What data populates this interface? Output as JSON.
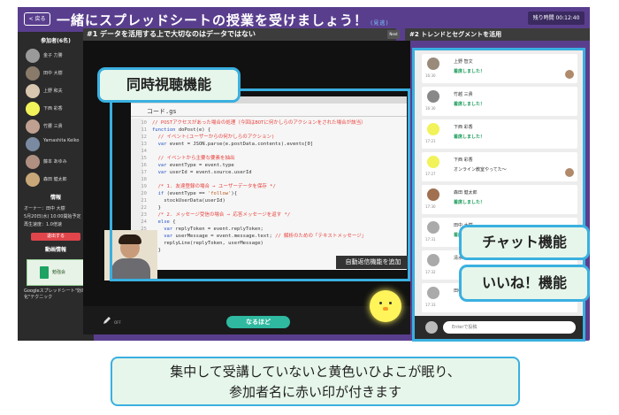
{
  "titlebar": {
    "back_label": "< 戻る",
    "title": "一緒にスプレッドシートの授業を受けましょう！",
    "title_tag": "(見逃)",
    "remaining_time": "残り時間 00:12:40"
  },
  "sidebar": {
    "participants_heading": "参加者(6名)",
    "members": [
      {
        "name": "金子 力勝"
      },
      {
        "name": "田中 大樹"
      },
      {
        "name": "上野 和夫"
      },
      {
        "name": "下西 彩香"
      },
      {
        "name": "竹腰 三貴"
      },
      {
        "name": "Yamashita Keiko"
      },
      {
        "name": "藤本 あゆみ"
      },
      {
        "name": "森田 健太郎"
      }
    ],
    "info_heading": "情報",
    "info_lines": [
      "オーナー：田中 大樹",
      "5月20日(水) 10:00開始予定",
      "再生速度：1.0倍速"
    ],
    "exit_label": "退出する",
    "video_heading": "動画情報",
    "video_thumb_text": "勉強会",
    "video_caption": "Googleスプレッドシート\"効率化\"テクニック"
  },
  "main": {
    "tab_label": "#1 データを活用する上で大切なのはデータではない",
    "next_label": "Next",
    "file_tab": "コード.gs",
    "code_lines": [
      {
        "ln": "10",
        "segs": [
          {
            "t": "// POSTアクセスがあった場合の処理（今回はBOTに何かしらのアクションをされた場合が該当）",
            "c": "c-cm"
          }
        ]
      },
      {
        "ln": "11",
        "segs": [
          {
            "t": "function ",
            "c": "c-kw"
          },
          {
            "t": "doPost(e) {",
            "c": ""
          }
        ]
      },
      {
        "ln": "12",
        "segs": [
          {
            "t": "  // イベント(ユーザーからの何かしらのアクション)",
            "c": "c-cm"
          }
        ]
      },
      {
        "ln": "13",
        "segs": [
          {
            "t": "  var ",
            "c": "c-kw"
          },
          {
            "t": "event = JSON.parse(e.postData.contents).events[0]",
            "c": ""
          }
        ]
      },
      {
        "ln": "14",
        "segs": [
          {
            "t": "",
            "c": ""
          }
        ]
      },
      {
        "ln": "15",
        "segs": [
          {
            "t": "  // イベントから主要な要素を抽出",
            "c": "c-cm"
          }
        ]
      },
      {
        "ln": "16",
        "segs": [
          {
            "t": "  var ",
            "c": "c-kw"
          },
          {
            "t": "eventType = event.type",
            "c": ""
          }
        ]
      },
      {
        "ln": "17",
        "segs": [
          {
            "t": "  var ",
            "c": "c-kw"
          },
          {
            "t": "userId = event.source.userId",
            "c": ""
          }
        ]
      },
      {
        "ln": "18",
        "segs": [
          {
            "t": "",
            "c": ""
          }
        ]
      },
      {
        "ln": "19",
        "segs": [
          {
            "t": "  /* 1. 友達登録の場合 → ユーザーデータを保存 */",
            "c": "c-cm"
          }
        ]
      },
      {
        "ln": "20",
        "segs": [
          {
            "t": "  if ",
            "c": "c-kw"
          },
          {
            "t": "(eventType == ",
            "c": ""
          },
          {
            "t": "'follow'",
            "c": "c-st"
          },
          {
            "t": "){",
            "c": ""
          }
        ]
      },
      {
        "ln": "21",
        "segs": [
          {
            "t": "    stockUserData(userId)",
            "c": ""
          }
        ]
      },
      {
        "ln": "22",
        "segs": [
          {
            "t": "  }",
            "c": ""
          }
        ]
      },
      {
        "ln": "23",
        "segs": [
          {
            "t": "  /* 2. メッセージ受信の場合 → 応答メッセージを返す */",
            "c": "c-cm"
          }
        ]
      },
      {
        "ln": "24",
        "segs": [
          {
            "t": "  else ",
            "c": "c-kw"
          },
          {
            "t": "{",
            "c": ""
          }
        ]
      },
      {
        "ln": "25",
        "segs": [
          {
            "t": "    var ",
            "c": "c-kw"
          },
          {
            "t": "replyToken = event.replyToken;",
            "c": ""
          }
        ]
      },
      {
        "ln": "26",
        "segs": [
          {
            "t": "    var ",
            "c": "c-kw"
          },
          {
            "t": "userMessage = event.message.text; ",
            "c": ""
          },
          {
            "t": "// 解析のための「テキストメッセージ」",
            "c": "c-cm"
          }
        ]
      },
      {
        "ln": "27",
        "segs": [
          {
            "t": "    replyLine(replyToken, userMessage)",
            "c": ""
          }
        ]
      },
      {
        "ln": "28",
        "segs": [
          {
            "t": "  }",
            "c": ""
          }
        ]
      }
    ],
    "video_caption": "自動返信機能を追加",
    "off_label": "OFF",
    "good_label": "なるほど"
  },
  "right": {
    "tab_label": "#2 トレンドとセグメントを活用",
    "messages": [
      {
        "name": "上野 智文",
        "text": "着席しました！",
        "time": "16:30",
        "plain": false
      },
      {
        "name": "竹越 三貴",
        "text": "着席しました！",
        "time": "16:30",
        "plain": false
      },
      {
        "name": "下西 彩香",
        "text": "着席しました！",
        "time": "17:21",
        "plain": false
      },
      {
        "name": "下西 彩香",
        "text": "オンライン教室やってた〜",
        "time": "17:27",
        "plain": true
      },
      {
        "name": "森田 健太郎",
        "text": "着席しました！",
        "time": "17:30",
        "plain": false
      },
      {
        "name": "田中 大樹",
        "text": "着席",
        "time": "17:31",
        "plain": false
      },
      {
        "name": "清水",
        "text": "",
        "time": "17:32",
        "plain": true
      },
      {
        "name": "田中",
        "text": "",
        "time": "17:33",
        "plain": true
      }
    ],
    "input_placeholder": "Enterで投稿"
  },
  "callouts": {
    "sync": "同時視聴機能",
    "chat": "チャット機能",
    "like": "いいね！機能"
  },
  "caption": {
    "line1": "集中して受講していないと黄色いひよこが眠り、",
    "line2": "参加者名に赤い印が付きます"
  },
  "colors": {
    "app_purple": "#5a3e8e",
    "accent_blue": "#3ab0e0",
    "callout_green": "#e6f6ea",
    "good_button": "#2fb9a0",
    "chick_yellow": "#fff45a"
  }
}
